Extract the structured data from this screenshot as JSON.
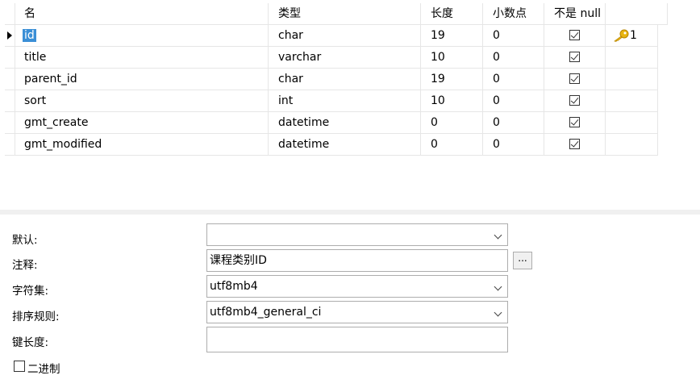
{
  "grid": {
    "headers": [
      "名",
      "类型",
      "长度",
      "小数点",
      "不是 null",
      ""
    ],
    "rows": [
      {
        "name": "id",
        "type": "char",
        "length": "19",
        "decimals": "0",
        "not_null": true,
        "key": "1"
      },
      {
        "name": "title",
        "type": "varchar",
        "length": "10",
        "decimals": "0",
        "not_null": true,
        "key": ""
      },
      {
        "name": "parent_id",
        "type": "char",
        "length": "19",
        "decimals": "0",
        "not_null": true,
        "key": ""
      },
      {
        "name": "sort",
        "type": "int",
        "length": "10",
        "decimals": "0",
        "not_null": true,
        "key": ""
      },
      {
        "name": "gmt_create",
        "type": "datetime",
        "length": "0",
        "decimals": "0",
        "not_null": true,
        "key": ""
      },
      {
        "name": "gmt_modified",
        "type": "datetime",
        "length": "0",
        "decimals": "0",
        "not_null": true,
        "key": ""
      }
    ],
    "key_icon": "key-icon",
    "selection_color": "#3b8fd6"
  },
  "props": {
    "default_label": "默认:",
    "default_value": "",
    "comment_label": "注释:",
    "comment_value": "课程类别ID",
    "ellipsis_label": "...",
    "charset_label": "字符集:",
    "charset_value": "utf8mb4",
    "collation_label": "排序规则:",
    "collation_value": "utf8mb4_general_ci",
    "keylen_label": "键长度:",
    "keylen_value": "",
    "binary_label": "二进制",
    "binary_checked": false
  }
}
